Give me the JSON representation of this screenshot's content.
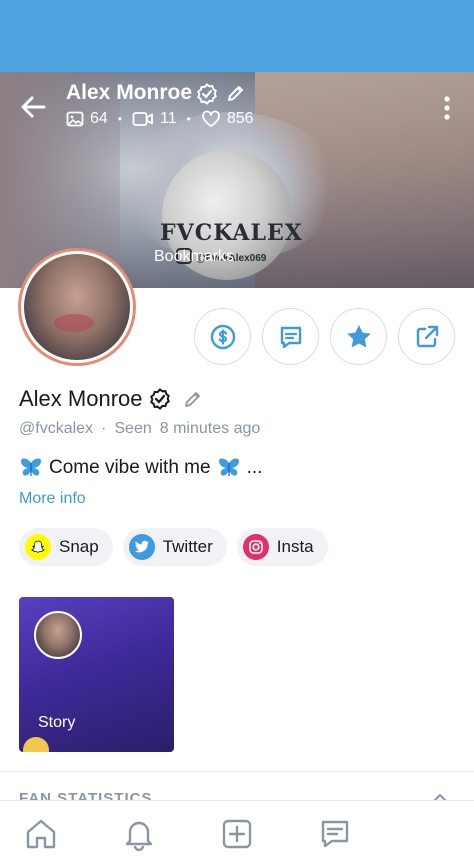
{
  "profile": {
    "name": "Alex Monroe",
    "handle": "@fvckalex",
    "seen_prefix": "Seen",
    "seen_time": "8 minutes ago",
    "bio": "Come vibe with me",
    "bio_suffix": "...",
    "more_info": "More info"
  },
  "header": {
    "name": "Alex Monroe",
    "photos": "64",
    "videos": "11",
    "likes": "856"
  },
  "cover": {
    "title": "FVCKALEX",
    "handle": "@FvckAlex069",
    "bookmarks": "Bookmarks"
  },
  "actions": [
    {
      "name": "tip",
      "icon": "dollar-icon"
    },
    {
      "name": "message",
      "icon": "message-icon"
    },
    {
      "name": "favorite",
      "icon": "star-icon"
    },
    {
      "name": "share",
      "icon": "share-icon"
    }
  ],
  "socials": [
    {
      "label": "Snap",
      "color": "#fffc00"
    },
    {
      "label": "Twitter",
      "color": "#3d9be0"
    },
    {
      "label": "Insta",
      "color": "#e1306c"
    }
  ],
  "story": {
    "label": "Story"
  },
  "fan_stats": {
    "label": "FAN STATISTICS"
  },
  "colors": {
    "accent": "#3d9be0",
    "status_bar": "#4ea3e0",
    "muted": "#8a96a3"
  }
}
